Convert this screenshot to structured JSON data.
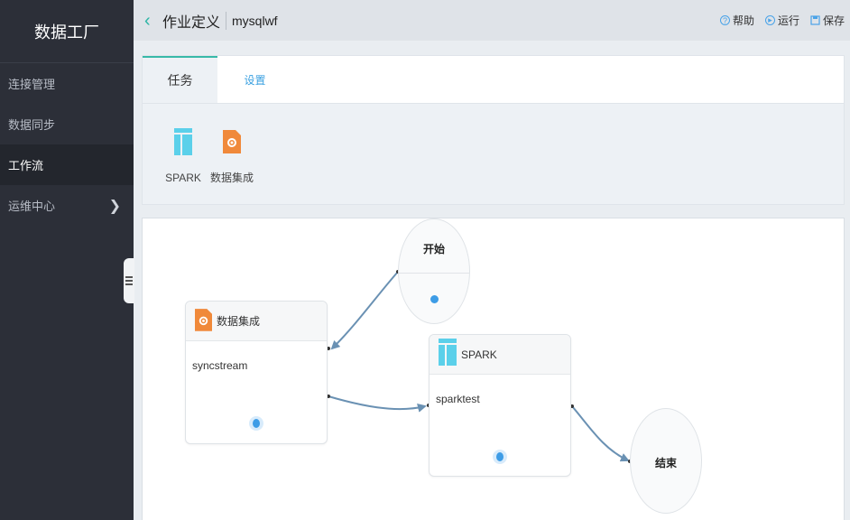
{
  "app": {
    "title": "数据工厂"
  },
  "sidebar": {
    "items": [
      {
        "label": "连接管理",
        "active": false
      },
      {
        "label": "数据同步",
        "active": false
      },
      {
        "label": "工作流",
        "active": true
      },
      {
        "label": "运维中心",
        "active": false,
        "has_submenu": true
      }
    ]
  },
  "header": {
    "title": "作业定义",
    "job_name": "mysqlwf",
    "actions": [
      {
        "label": "帮助",
        "icon": "help-icon"
      },
      {
        "label": "运行",
        "icon": "run-icon"
      },
      {
        "label": "保存",
        "icon": "save-icon"
      }
    ]
  },
  "panel": {
    "tabs": [
      {
        "label": "任务",
        "active": true
      },
      {
        "label": "设置",
        "active": false
      }
    ],
    "tools": [
      {
        "label": "SPARK",
        "icon": "spark-icon",
        "color": "#5bd0ea"
      },
      {
        "label": "数据集成",
        "icon": "data-integration-icon",
        "color": "#f0893a"
      }
    ]
  },
  "canvas": {
    "start": {
      "label": "开始"
    },
    "end": {
      "label": "结束"
    },
    "nodes": [
      {
        "type": "数据集成",
        "name": "syncstream",
        "icon": "data-integration-icon"
      },
      {
        "type": "SPARK",
        "name": "sparktest",
        "icon": "spark-icon"
      }
    ]
  },
  "colors": {
    "accent": "#38b9a8",
    "link": "#3aa0e0",
    "edge": "#6a91b3",
    "status": "#3d9ce6"
  }
}
